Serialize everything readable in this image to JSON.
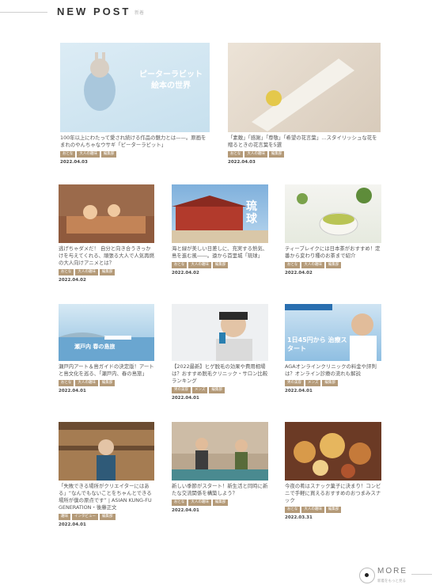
{
  "header": {
    "title": "NEW POST",
    "subtitle": "新着"
  },
  "cards": [
    {
      "title": "100年以上にわたって愛され続ける作品の魅力とは——。原画をまれのやんちゃなウサギ「ピーターラビット」",
      "tags": [
        "おとな",
        "大人の趣味",
        "編集部"
      ],
      "date": "2022.04.03",
      "overlay": "ピーターラビット絵本の世界"
    },
    {
      "title": "「素敵」「感謝」「尊敬」「希望の花言葉」…スタイリッシュな花を贈るときの花言葉を5選",
      "tags": [
        "おとな",
        "大人の趣味",
        "編集部"
      ],
      "date": "2022.04.03",
      "overlay": ""
    },
    {
      "title": "逃げちゃダメだ！ 自分と向き合うきっかけを与えてくれる、頑張る大人で人気再燃の大人向けアニメとは？",
      "tags": [
        "おとな",
        "大人の趣味",
        "編集部"
      ],
      "date": "2022.04.02",
      "overlay": ""
    },
    {
      "title": "海と緑が美しい日差しに、充実する熱気、島を進む風――。遠から首里城「琉球」",
      "tags": [
        "おとな",
        "大人の趣味",
        "編集部"
      ],
      "date": "2022.04.02",
      "overlay": "琉球"
    },
    {
      "title": "ティーブレイクには日本茶がおすすめ！定番から変わり種のお茶まで紹介",
      "tags": [
        "おとな",
        "大人の趣味",
        "編集部"
      ],
      "date": "2022.04.02",
      "overlay": ""
    },
    {
      "title": "瀬戸内アート＆島ガイドの決定版！アートと島文化を巡る、「瀬戸内、春の島旅」",
      "tags": [
        "おとな",
        "大人の趣味",
        "編集部"
      ],
      "date": "2022.04.01",
      "overlay": "瀬戸内 春の島旅"
    },
    {
      "title": "【2022最新】ヒゲ脱毛の効果や費用相場は？おすすめ脱毛クリニック・サロン比較ランキング",
      "tags": [
        "男の美容",
        "メンズ",
        "編集部"
      ],
      "date": "2022.04.01",
      "overlay": ""
    },
    {
      "title": "AGAオンラインクリニックの料金や評判は？オンライン診療の流れも解説",
      "tags": [
        "男の美容",
        "メンズ",
        "編集部"
      ],
      "date": "2022.04.01",
      "overlay": "1日45円から 治療スタート"
    },
    {
      "title": "「失敗できる場所がクリエイターにはある」“なんでもないことをちゃんとできる場所が僕の原点です” | ASIAN KUNG-FU GENERATION・後藤正文",
      "tags": [
        "趣味",
        "インタビュー",
        "編集部"
      ],
      "date": "2022.04.01",
      "overlay": ""
    },
    {
      "title": "新しい季節がスタート！新生活と同時に新たな交流関係を構築しよう？",
      "tags": [
        "おとな",
        "大人の趣味",
        "編集部"
      ],
      "date": "2022.04.01",
      "overlay": ""
    },
    {
      "title": "今夜の肴はスナック菓子に決まり！コンビニで手軽に買えるおすすめのおつまみスナック",
      "tags": [
        "おとな",
        "大人の趣味",
        "編集部"
      ],
      "date": "2022.03.31",
      "overlay": ""
    }
  ],
  "more": {
    "label": "MORE",
    "sub": "新着をもっと見る"
  }
}
